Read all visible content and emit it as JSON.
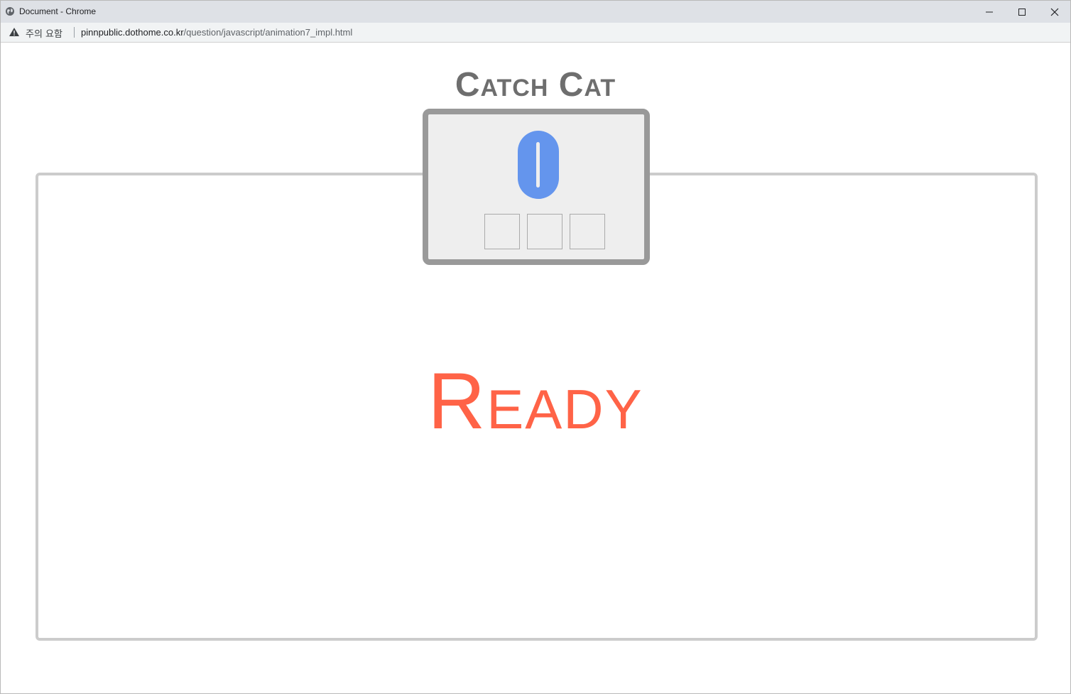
{
  "window": {
    "title": "Document - Chrome"
  },
  "addressbar": {
    "security_label": "주의 요함",
    "url_host": "pinnpublic.dothome.co.kr",
    "url_path": "/question/javascript/animation7_impl.html"
  },
  "game": {
    "title": "Catch Cat",
    "score": "0",
    "lives": [
      "",
      "",
      ""
    ],
    "status": "Ready"
  },
  "colors": {
    "title": "#6e6e6e",
    "scoreboard_border": "#999999",
    "scoreboard_bg": "#eeeeee",
    "score_digit": "#6495ed",
    "status_text": "#ff6347",
    "stage_border": "#cccccc"
  },
  "icons": {
    "window": "globe-icon",
    "security": "warning-icon",
    "minimize": "minimize-icon",
    "maximize": "maximize-icon",
    "close": "close-icon"
  }
}
